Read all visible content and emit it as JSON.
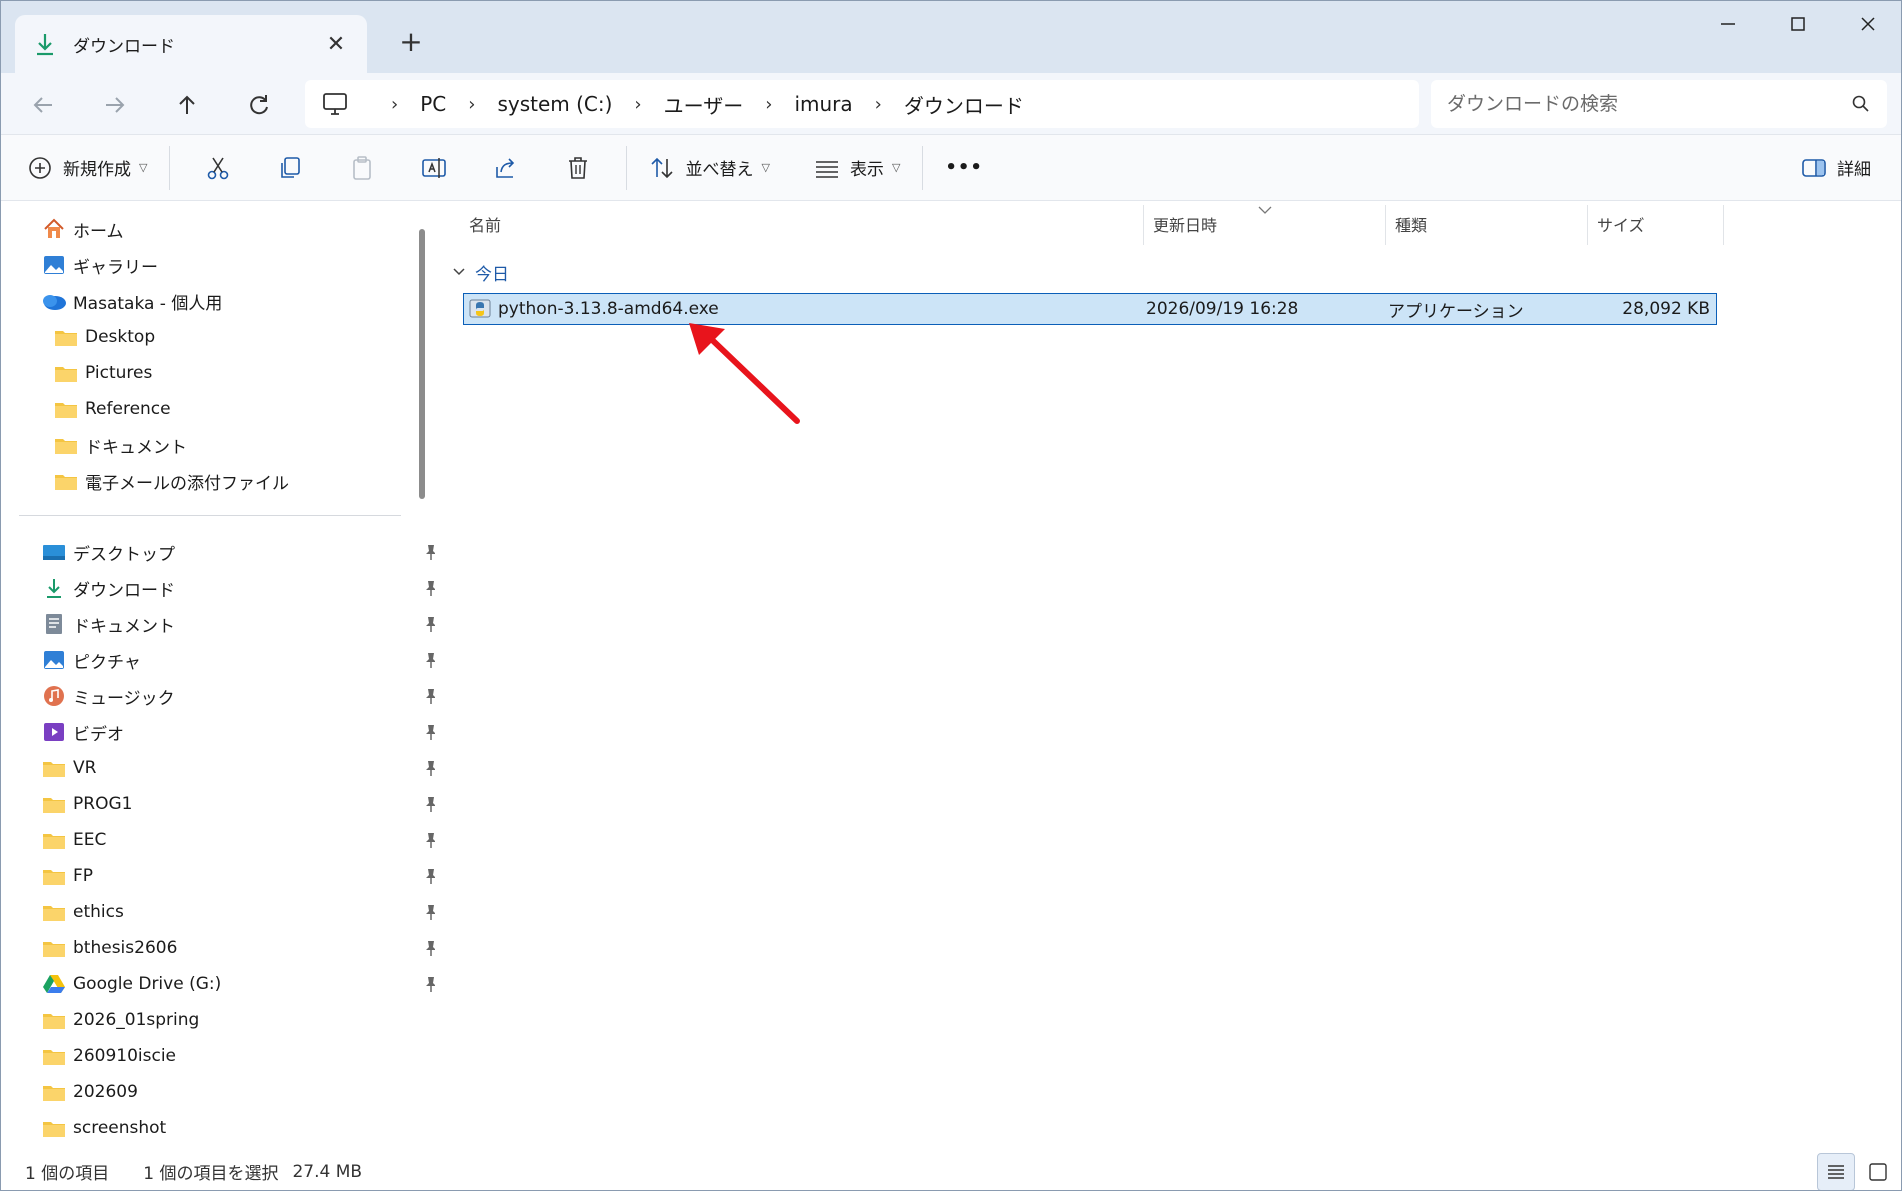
{
  "tab": {
    "title": "ダウンロード",
    "close_glyph": "✕",
    "new_glyph": "+"
  },
  "address": {
    "crumbs": [
      "PC",
      "system (C:)",
      "ユーザー",
      "imura",
      "ダウンロード"
    ]
  },
  "search": {
    "placeholder": "ダウンロードの検索"
  },
  "toolbar": {
    "new_label": "新規作成",
    "sort_label": "並べ替え",
    "view_label": "表示",
    "more_label": "•••",
    "details_label": "詳細"
  },
  "sidebar": {
    "top_items": [
      {
        "label": "ホーム",
        "icon": "home-icon"
      },
      {
        "label": "ギャラリー",
        "icon": "gallery-icon"
      },
      {
        "label": "Masataka - 個人用",
        "icon": "onedrive-icon"
      },
      {
        "label": "Desktop",
        "icon": "folder-icon"
      },
      {
        "label": "Pictures",
        "icon": "folder-icon"
      },
      {
        "label": "Reference",
        "icon": "folder-icon"
      },
      {
        "label": "ドキュメント",
        "icon": "folder-icon"
      },
      {
        "label": "電子メールの添付ファイル",
        "icon": "folder-icon"
      }
    ],
    "quick_items": [
      {
        "label": "デスクトップ",
        "icon": "desktop-icon"
      },
      {
        "label": "ダウンロード",
        "icon": "download-icon"
      },
      {
        "label": "ドキュメント",
        "icon": "document-icon"
      },
      {
        "label": "ピクチャ",
        "icon": "pictures-icon"
      },
      {
        "label": "ミュージック",
        "icon": "music-icon"
      },
      {
        "label": "ビデオ",
        "icon": "video-icon"
      },
      {
        "label": "VR",
        "icon": "folder-icon"
      },
      {
        "label": "PROG1",
        "icon": "folder-icon"
      },
      {
        "label": "EEC",
        "icon": "folder-icon"
      },
      {
        "label": "FP",
        "icon": "folder-icon"
      },
      {
        "label": "ethics",
        "icon": "folder-icon"
      },
      {
        "label": "bthesis2606",
        "icon": "folder-icon"
      },
      {
        "label": "Google Drive (G:)",
        "icon": "google-drive-icon"
      },
      {
        "label": "2026_01spring",
        "icon": "folder-icon"
      },
      {
        "label": "260910iscie",
        "icon": "folder-icon"
      },
      {
        "label": "202609",
        "icon": "folder-icon"
      },
      {
        "label": "screenshot",
        "icon": "folder-icon"
      }
    ]
  },
  "columns": {
    "name": "名前",
    "modified": "更新日時",
    "type": "種類",
    "size": "サイズ"
  },
  "group": {
    "label": "今日"
  },
  "files": [
    {
      "name": "python-3.13.8-amd64.exe",
      "modified": "2026/09/19 16:28",
      "type": "アプリケーション",
      "size": "28,092 KB"
    }
  ],
  "status": {
    "count": "1 個の項目",
    "selected": "1 個の項目を選択",
    "selected_size": "27.4 MB"
  },
  "colors": {
    "accent": "#0b5fb8",
    "selection": "#cce4f7",
    "folder": "#f4c542",
    "arrow": "#e8141c"
  }
}
